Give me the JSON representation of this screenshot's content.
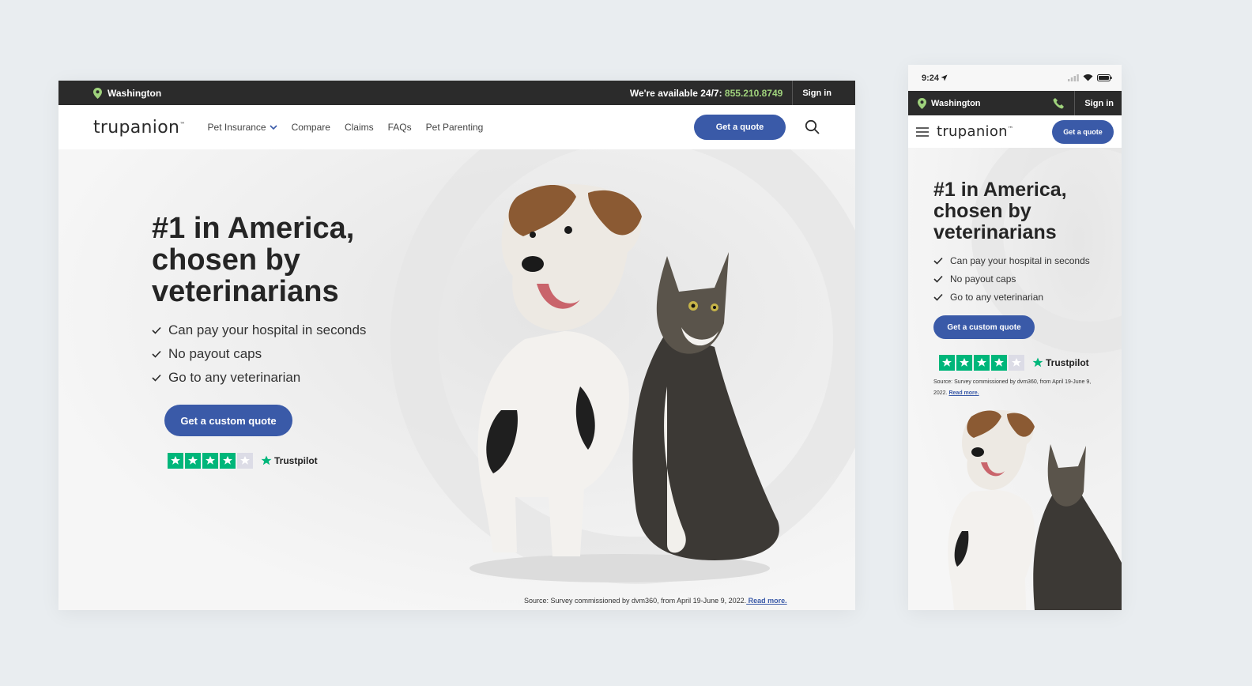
{
  "brand": {
    "logo_text": "trupanion",
    "trademark": "™",
    "primary_color": "#3a5aa8",
    "accent_color": "#9fd27c"
  },
  "desktop": {
    "topbar": {
      "location": "Washington",
      "available_label": "We're available 24/7: ",
      "phone": "855.210.8749",
      "signin": "Sign in"
    },
    "nav": {
      "items": [
        {
          "label": "Pet Insurance",
          "has_dropdown": true
        },
        {
          "label": "Compare"
        },
        {
          "label": "Claims"
        },
        {
          "label": "FAQs"
        },
        {
          "label": "Pet Parenting"
        }
      ],
      "quote_button": "Get a quote",
      "search_icon": "search-icon"
    },
    "hero": {
      "headline": "#1 in America, chosen by veterinarians",
      "benefits": [
        "Can pay your hospital in seconds",
        "No payout caps",
        "Go to any veterinarian"
      ],
      "cta": "Get a custom quote",
      "trustpilot": {
        "name": "Trustpilot",
        "stars": 4,
        "max_stars": 5
      },
      "source_text": "Source: Survey commissioned by dvm360, from April 19-June 9, 2022.",
      "read_more": " Read more."
    }
  },
  "mobile": {
    "status": {
      "time": "9:24"
    },
    "topbar": {
      "location": "Washington",
      "signin": "Sign in"
    },
    "nav": {
      "quote_button": "Get a quote"
    },
    "hero": {
      "headline": "#1 in America, chosen by veterinarians",
      "benefits": [
        "Can pay your hospital in seconds",
        "No payout caps",
        "Go to any veterinarian"
      ],
      "cta": "Get a custom quote",
      "trustpilot": {
        "name": "Trustpilot",
        "stars": 4,
        "max_stars": 5
      },
      "source_text": "Source: Survey commissioned by dvm360, from April 19-June 9, 2022.",
      "read_more": "Read more."
    }
  }
}
